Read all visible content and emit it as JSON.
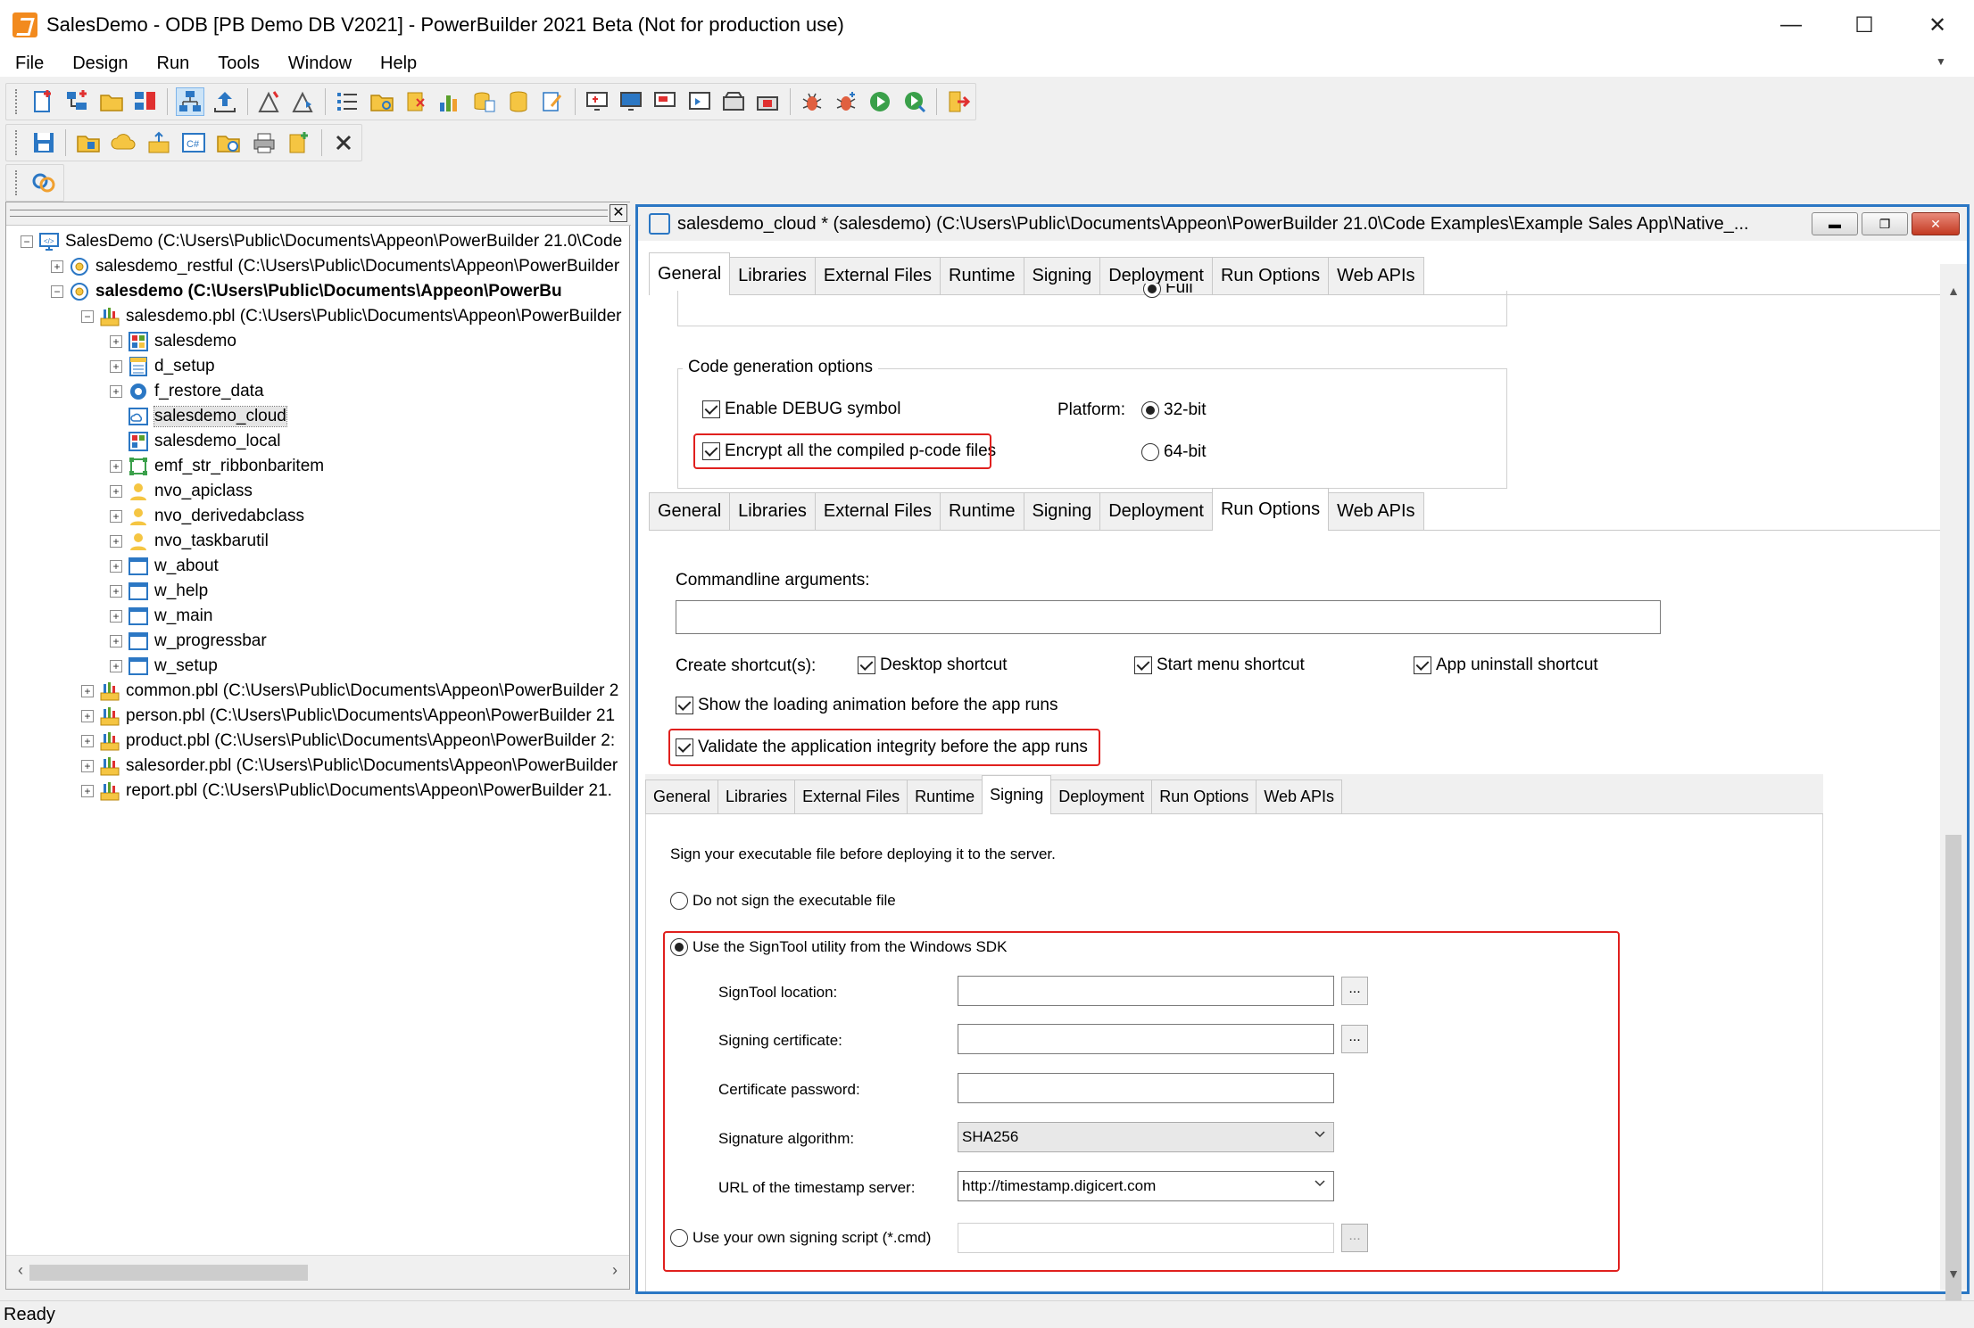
{
  "window": {
    "title": "SalesDemo - ODB [PB Demo DB V2021]  - PowerBuilder 2021 Beta (Not for production use)",
    "minimize": "—",
    "maximize": "☐",
    "close": "✕"
  },
  "menu": [
    "File",
    "Design",
    "Run",
    "Tools",
    "Window",
    "Help"
  ],
  "tree": {
    "workspace": "SalesDemo (C:\\Users\\Public\\Documents\\Appeon\\PowerBuilder 21.0\\Code",
    "targets": [
      {
        "label": "salesdemo_restful (C:\\Users\\Public\\Documents\\Appeon\\PowerBuilder"
      },
      {
        "label": "salesdemo (C:\\Users\\Public\\Documents\\Appeon\\PowerBu"
      }
    ],
    "pbl": "salesdemo.pbl (C:\\Users\\Public\\Documents\\Appeon\\PowerBuilder",
    "objects": [
      "salesdemo",
      "d_setup",
      "f_restore_data",
      "salesdemo_cloud",
      "salesdemo_local",
      "emf_str_ribbonbaritem",
      "nvo_apiclass",
      "nvo_derivedabclass",
      "nvo_taskbarutil",
      "w_about",
      "w_help",
      "w_main",
      "w_progressbar",
      "w_setup"
    ],
    "libs": [
      "common.pbl (C:\\Users\\Public\\Documents\\Appeon\\PowerBuilder 2",
      "person.pbl (C:\\Users\\Public\\Documents\\Appeon\\PowerBuilder 21",
      "product.pbl (C:\\Users\\Public\\Documents\\Appeon\\PowerBuilder 2:",
      "salesorder.pbl (C:\\Users\\Public\\Documents\\Appeon\\PowerBuilder",
      "report.pbl (C:\\Users\\Public\\Documents\\Appeon\\PowerBuilder 21."
    ]
  },
  "mdi": {
    "title": "salesdemo_cloud * (salesdemo) (C:\\Users\\Public\\Documents\\Appeon\\PowerBuilder 21.0\\Code Examples\\Example Sales App\\Native_..."
  },
  "tabs": [
    "General",
    "Libraries",
    "External Files",
    "Runtime",
    "Signing",
    "Deployment",
    "Run Options",
    "Web APIs"
  ],
  "general": {
    "partial_radio": "Full",
    "group_label": "Code generation options",
    "debug": "Enable DEBUG symbol",
    "encrypt": "Encrypt all the compiled p-code files",
    "platform_label": "Platform:",
    "p32": "32-bit",
    "p64": "64-bit"
  },
  "run_options": {
    "args_label": "Commandline arguments:",
    "args_value": "",
    "shortcut_label": "Create shortcut(s):",
    "desktop": "Desktop shortcut",
    "start_menu": "Start menu shortcut",
    "uninstall": "App uninstall shortcut",
    "loading": "Show the loading animation before the app runs",
    "validate": "Validate the application integrity before the app runs"
  },
  "signing": {
    "intro": "Sign your executable file before deploying it to the server.",
    "no_sign": "Do not sign the executable file",
    "signtool": "Use the SignTool utility from the Windows SDK",
    "location_label": "SignTool location:",
    "cert_label": "Signing certificate:",
    "password_label": "Certificate password:",
    "algo_label": "Signature algorithm:",
    "algo_value": "SHA256",
    "url_label": "URL of the timestamp server:",
    "url_value": "http://timestamp.digicert.com",
    "own_script": "Use your own signing script (*.cmd)",
    "browse": "..."
  },
  "status": "Ready",
  "colors": {
    "highlight": "#e0201e",
    "accent": "#2b77c4"
  }
}
